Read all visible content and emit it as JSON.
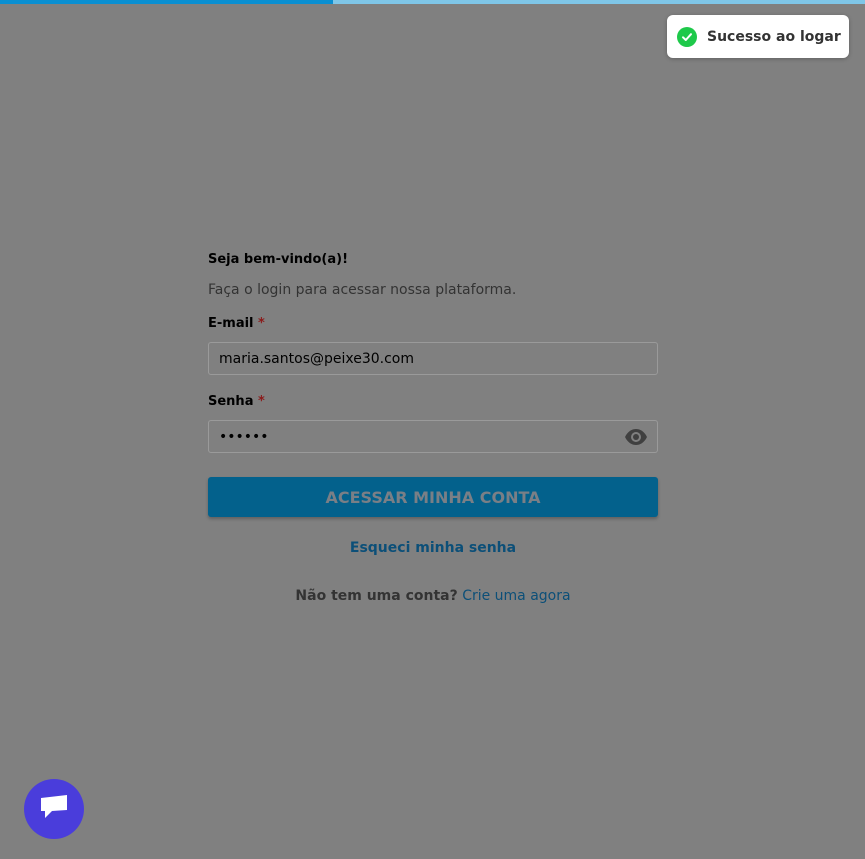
{
  "top_progress": {
    "percent": 38.5,
    "track_color": "#7fc6e8",
    "fill_color": "#0a8fd1"
  },
  "toast": {
    "message": "Sucesso ao logar",
    "icon": "check-circle-icon",
    "icon_color": "#1ec94a"
  },
  "login": {
    "welcome": "Seja bem-vindo(a)!",
    "subtitle": "Faça o login para acessar nossa plataforma.",
    "email": {
      "label": "E-mail",
      "required_mark": "*",
      "value": "maria.santos@peixe30.com"
    },
    "password": {
      "label": "Senha",
      "required_mark": "*",
      "masked_value": "••••••",
      "toggle_icon": "eye-icon"
    },
    "submit_label": "ACESSAR MINHA CONTA",
    "forgot_label": "Esqueci minha senha",
    "signup_question": "Não tem uma conta?",
    "signup_link": "Crie uma agora"
  },
  "chat": {
    "icon": "chat-bubble-icon",
    "color": "#4a3ddb"
  },
  "colors": {
    "overlay_background": "#808080",
    "button_background": "#03618c",
    "link": "#0c4f78"
  }
}
